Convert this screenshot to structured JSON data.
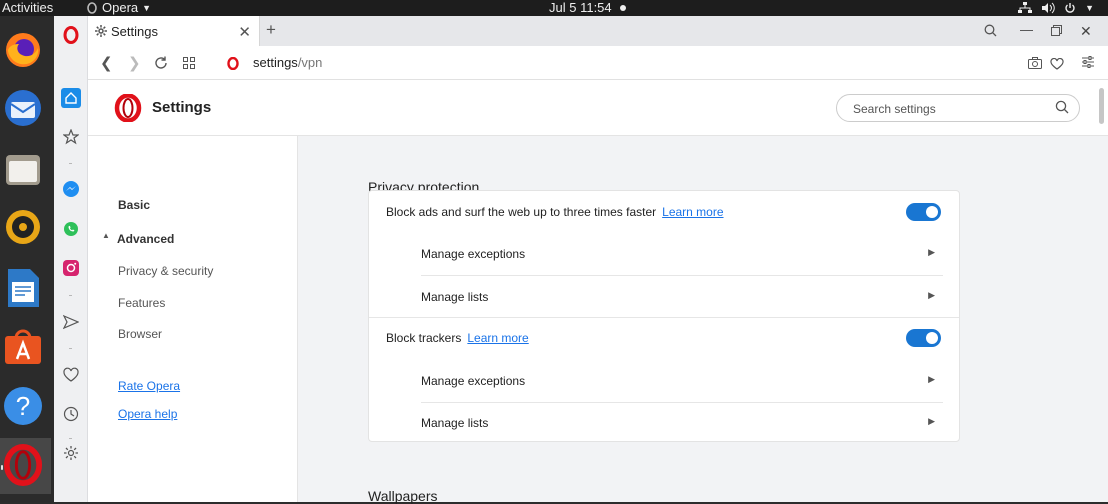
{
  "topbar": {
    "activities": "Activities",
    "app_name": "Opera",
    "clock": "Jul 5  11:54"
  },
  "dock": {
    "apps": [
      "firefox-icon",
      "thunderbird-icon",
      "files-icon",
      "rhythmbox-icon",
      "libreoffice-writer-icon",
      "software-center-icon",
      "help-icon",
      "opera-icon"
    ]
  },
  "browser": {
    "tab_title": "Settings",
    "url_host": "settings",
    "url_path": "/vpn"
  },
  "settings": {
    "header_title": "Settings",
    "search_placeholder": "Search settings",
    "nav": {
      "basic": "Basic",
      "advanced": "Advanced",
      "privacy": "Privacy & security",
      "features": "Features",
      "browser": "Browser",
      "rate": "Rate Opera",
      "help": "Opera help"
    },
    "privacy_protection": {
      "title": "Privacy protection",
      "block_ads": {
        "label": "Block ads and surf the web up to three times faster",
        "learn_more": "Learn more",
        "enabled": true,
        "manage_exceptions": "Manage exceptions",
        "manage_lists": "Manage lists"
      },
      "block_trackers": {
        "label": "Block trackers",
        "learn_more": "Learn more",
        "enabled": true,
        "manage_exceptions": "Manage exceptions",
        "manage_lists": "Manage lists"
      }
    },
    "wallpapers_title": "Wallpapers"
  },
  "colors": {
    "accent": "#1976d2",
    "opera_red": "#e1111a",
    "link": "#1a73e8"
  }
}
